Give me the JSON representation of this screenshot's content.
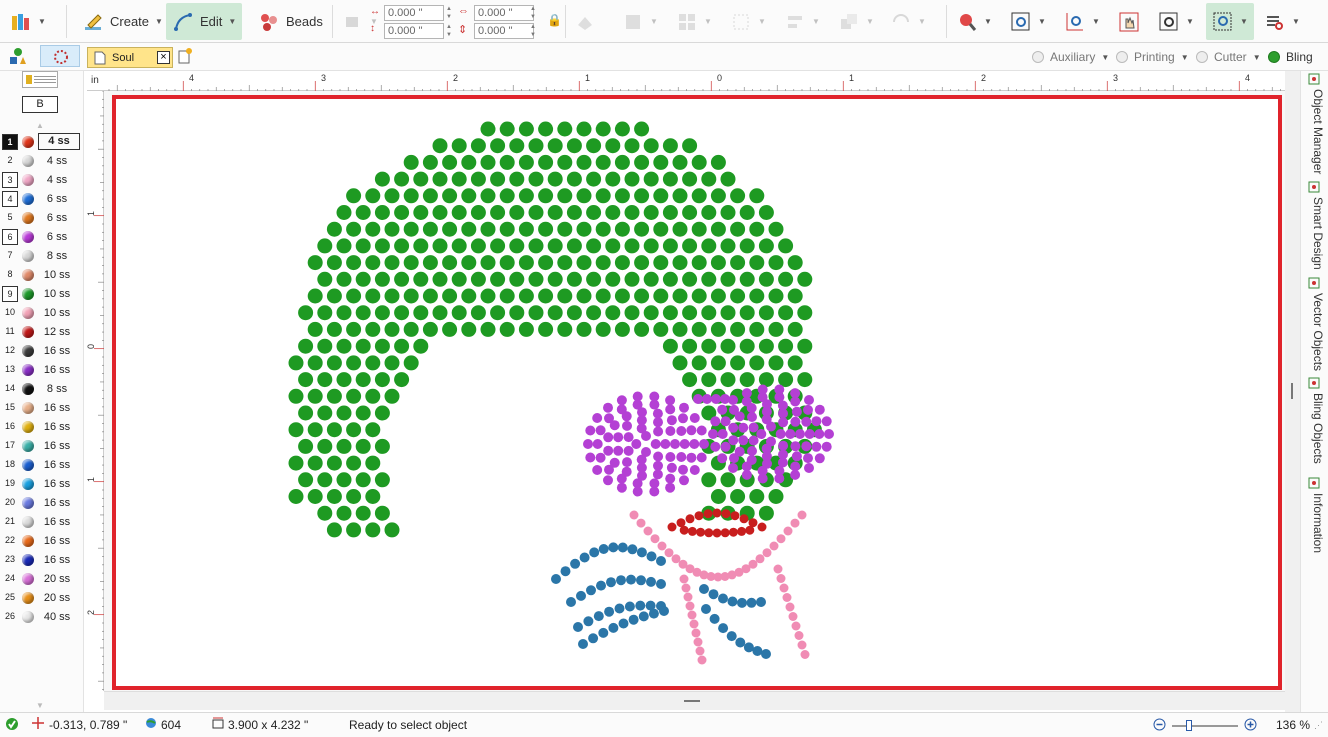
{
  "toolbar": {
    "create_label": "Create",
    "edit_label": "Edit",
    "beads_label": "Beads",
    "pos_x": "0.000 \"",
    "pos_y": "0.000 \"",
    "size_w": "0.000 \"",
    "size_h": "0.000 \""
  },
  "document": {
    "tab_title": "Soul"
  },
  "side_selector": {
    "label": "B"
  },
  "modes": [
    {
      "label": "Auxiliary",
      "active": false
    },
    {
      "label": "Printing",
      "active": false
    },
    {
      "label": "Cutter",
      "active": false
    },
    {
      "label": "Bling",
      "active": true
    }
  ],
  "ruler": {
    "unit": "in",
    "top_labels": [
      "4",
      "3",
      "2",
      "1",
      "0",
      "1",
      "2",
      "3",
      "4"
    ],
    "left_labels": [
      "1",
      "0",
      "1",
      "2"
    ]
  },
  "palette": [
    {
      "num": "1",
      "size": "4 ss",
      "color": "#e0361b",
      "boxed": true,
      "selected": true
    },
    {
      "num": "2",
      "size": "4 ss",
      "color": "#d8d8d8",
      "boxed": false
    },
    {
      "num": "3",
      "size": "4 ss",
      "color": "#f0a7c6",
      "boxed": true
    },
    {
      "num": "4",
      "size": "6 ss",
      "color": "#1f6fd8",
      "boxed": true
    },
    {
      "num": "5",
      "size": "6 ss",
      "color": "#e0781f",
      "boxed": false
    },
    {
      "num": "6",
      "size": "6 ss",
      "color": "#b93ad8",
      "boxed": true
    },
    {
      "num": "7",
      "size": "8 ss",
      "color": "#d6d6d6",
      "boxed": false
    },
    {
      "num": "8",
      "size": "10 ss",
      "color": "#e08a6a",
      "boxed": false
    },
    {
      "num": "9",
      "size": "10 ss",
      "color": "#1e9a2a",
      "boxed": true
    },
    {
      "num": "10",
      "size": "10 ss",
      "color": "#f2a2b6",
      "boxed": false
    },
    {
      "num": "11",
      "size": "12 ss",
      "color": "#c01818",
      "boxed": false
    },
    {
      "num": "12",
      "size": "16 ss",
      "color": "#3c3c3c",
      "boxed": false
    },
    {
      "num": "13",
      "size": "16 ss",
      "color": "#8a2fc6",
      "boxed": false
    },
    {
      "num": "14",
      "size": "8 ss",
      "color": "#111111",
      "boxed": false
    },
    {
      "num": "15",
      "size": "16 ss",
      "color": "#e8b08a",
      "boxed": false
    },
    {
      "num": "16",
      "size": "16 ss",
      "color": "#e0b010",
      "boxed": false
    },
    {
      "num": "17",
      "size": "16 ss",
      "color": "#3bb0a8",
      "boxed": false
    },
    {
      "num": "18",
      "size": "16 ss",
      "color": "#1b5fd0",
      "boxed": false
    },
    {
      "num": "19",
      "size": "16 ss",
      "color": "#1aa0e0",
      "boxed": false
    },
    {
      "num": "20",
      "size": "16 ss",
      "color": "#6a7ae0",
      "boxed": false
    },
    {
      "num": "21",
      "size": "16 ss",
      "color": "#dcdcdc",
      "boxed": false
    },
    {
      "num": "22",
      "size": "16 ss",
      "color": "#e86a1a",
      "boxed": false
    },
    {
      "num": "23",
      "size": "16 ss",
      "color": "#1a2ab8",
      "boxed": false
    },
    {
      "num": "24",
      "size": "20 ss",
      "color": "#d870d8",
      "boxed": false
    },
    {
      "num": "25",
      "size": "20 ss",
      "color": "#e8901a",
      "boxed": false
    },
    {
      "num": "26",
      "size": "40 ss",
      "color": "#e8e8e8",
      "boxed": false
    }
  ],
  "right_tabs": [
    {
      "label": "Object Manager",
      "icon": "object-manager-icon"
    },
    {
      "label": "Smart Design",
      "icon": "smart-design-icon"
    },
    {
      "label": "Vector Objects",
      "icon": "vector-objects-icon"
    },
    {
      "label": "Bling Objects",
      "icon": "bling-objects-icon"
    },
    {
      "label": "Information",
      "icon": "information-icon"
    }
  ],
  "colors": {
    "hair": "#1e9a22",
    "glasses": "#b440d4",
    "lips": "#c81e1e",
    "necklace": "#f08cb4",
    "bow": "#2b76a8",
    "frame": "#e0232b"
  },
  "status": {
    "cursor": "-0.313, 0.789 \"",
    "count": "604",
    "size": "3.900 x 4.232 \"",
    "message": "Ready to select object",
    "zoom": "136 %"
  }
}
